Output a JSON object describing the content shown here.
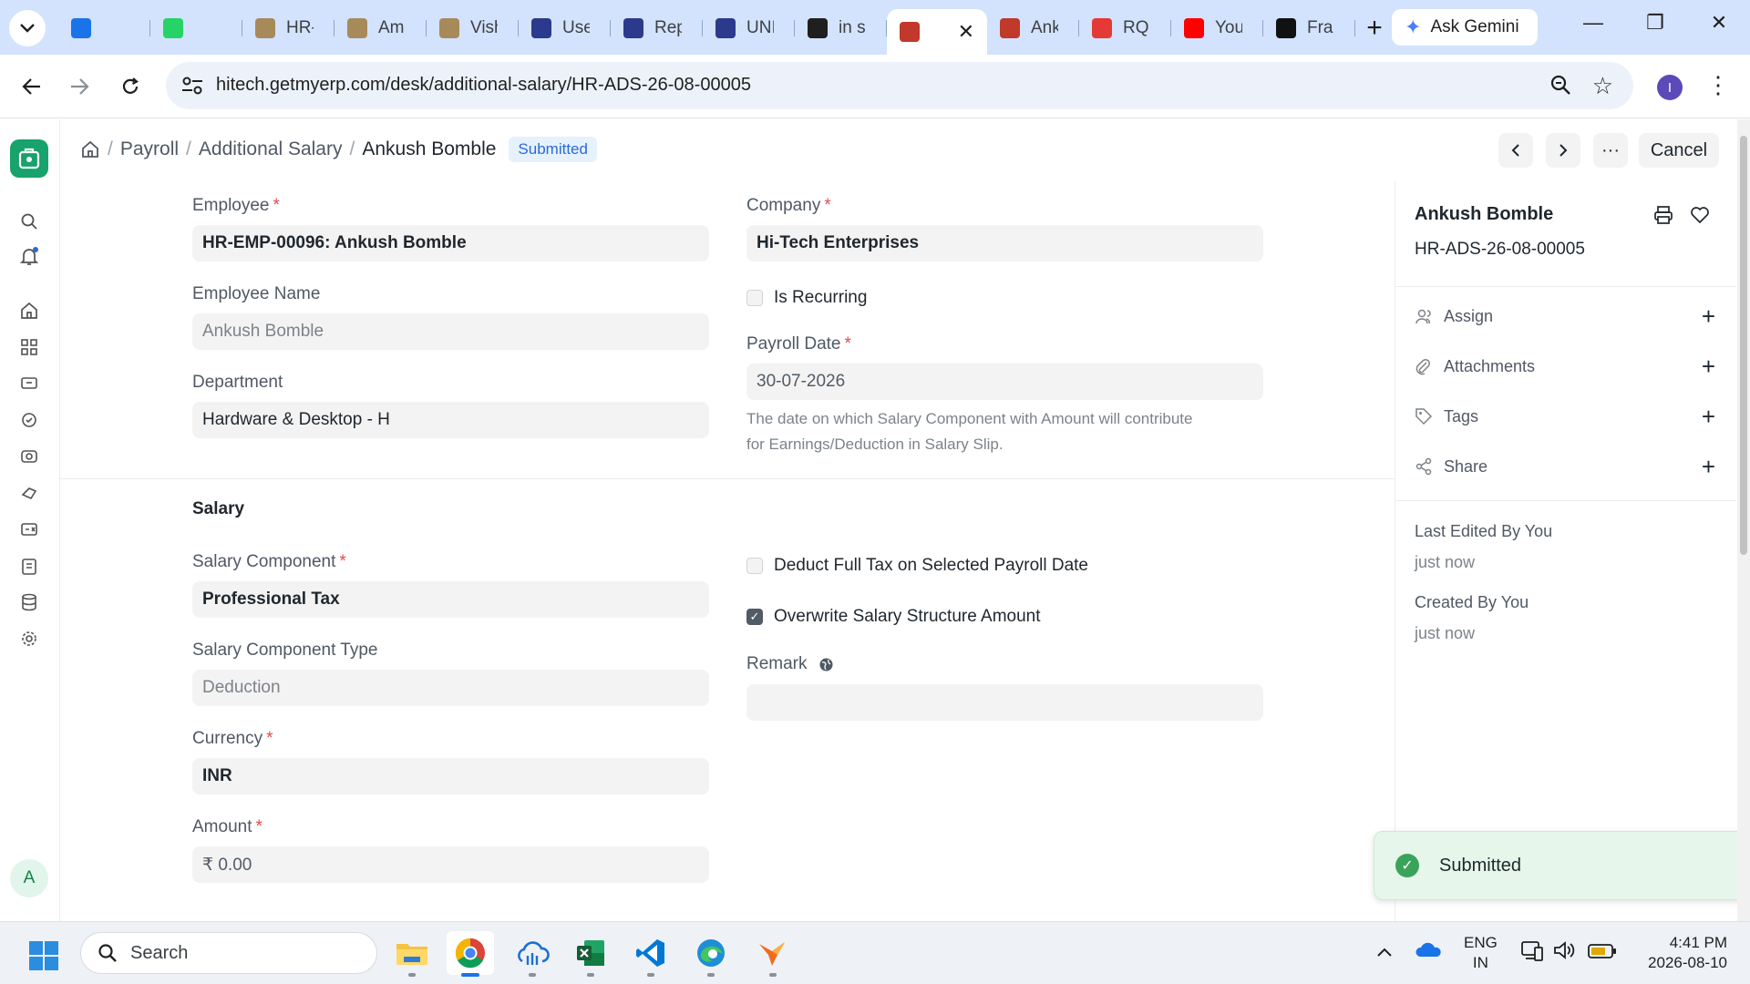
{
  "browser": {
    "tabs": [
      {
        "label": "",
        "icon": "outlook-icon",
        "color": "#1a73e8"
      },
      {
        "label": "",
        "icon": "whatsapp-icon",
        "color": "#25d366"
      },
      {
        "label": "HR-",
        "icon": "erp-icon",
        "color": "#a88a5a"
      },
      {
        "label": "Am",
        "icon": "erp-icon",
        "color": "#a88a5a"
      },
      {
        "label": "Vish",
        "icon": "erp-icon",
        "color": "#a88a5a"
      },
      {
        "label": "Use",
        "icon": "tally-icon",
        "color": "#2b3a8c"
      },
      {
        "label": "Rep",
        "icon": "tally-icon",
        "color": "#2b3a8c"
      },
      {
        "label": "UNI",
        "icon": "tally-icon",
        "color": "#2b3a8c"
      },
      {
        "label": "in s",
        "icon": "app-icon",
        "color": "#1f1f1f"
      },
      {
        "label": "",
        "icon": "frappe-icon",
        "color": "#c0392b",
        "active": true
      },
      {
        "label": "Ank",
        "icon": "frappe-icon",
        "color": "#c0392b"
      },
      {
        "label": "RQ",
        "icon": "rq-icon",
        "color": "#e53935"
      },
      {
        "label": "You",
        "icon": "youtube-icon",
        "color": "#ff0000"
      },
      {
        "label": "Fra",
        "icon": "frappe-f-icon",
        "color": "#111111"
      }
    ],
    "gemini_label": "Ask Gemini",
    "url": "hitech.getmyerp.com/desk/additional-salary/HR-ADS-26-08-00005",
    "profile_initial": "I"
  },
  "header": {
    "breadcrumb": [
      "Payroll",
      "Additional Salary"
    ],
    "current": "Ankush Bomble",
    "status": "Submitted",
    "cancel_label": "Cancel"
  },
  "form": {
    "employee": {
      "label": "Employee",
      "value": "HR-EMP-00096: Ankush Bomble"
    },
    "employee_name": {
      "label": "Employee Name",
      "value": "Ankush Bomble"
    },
    "department": {
      "label": "Department",
      "value": "Hardware & Desktop - H"
    },
    "company": {
      "label": "Company",
      "value": "Hi-Tech Enterprises"
    },
    "is_recurring": {
      "label": "Is Recurring",
      "checked": false
    },
    "payroll_date": {
      "label": "Payroll Date",
      "value": "30-07-2026",
      "help_line1": "The date on which Salary Component with Amount will contribute",
      "help_line2": "for Earnings/Deduction in Salary Slip."
    },
    "salary_section": "Salary",
    "salary_component": {
      "label": "Salary Component",
      "value": "Professional Tax"
    },
    "salary_component_type": {
      "label": "Salary Component Type",
      "value": "Deduction"
    },
    "currency": {
      "label": "Currency",
      "value": "INR"
    },
    "amount": {
      "label": "Amount",
      "value": "₹ 0.00"
    },
    "deduct_full_tax": {
      "label": "Deduct Full Tax on Selected Payroll Date",
      "checked": false
    },
    "overwrite_salary": {
      "label": "Overwrite Salary Structure Amount",
      "checked": true
    },
    "remark": {
      "label": "Remark",
      "value": ""
    }
  },
  "sidebar": {
    "title": "Ankush Bomble",
    "docname": "HR-ADS-26-08-00005",
    "actions": [
      "Assign",
      "Attachments",
      "Tags",
      "Share"
    ],
    "last_edited": "Last Edited By You",
    "last_edited_time": "just now",
    "created": "Created By You",
    "created_time": "just now"
  },
  "toast": {
    "message": "Submitted"
  },
  "user_initial": "A",
  "taskbar": {
    "search_placeholder": "Search",
    "lang_line1": "ENG",
    "lang_line2": "IN",
    "time": "4:41 PM",
    "date": "2026-08-10"
  }
}
